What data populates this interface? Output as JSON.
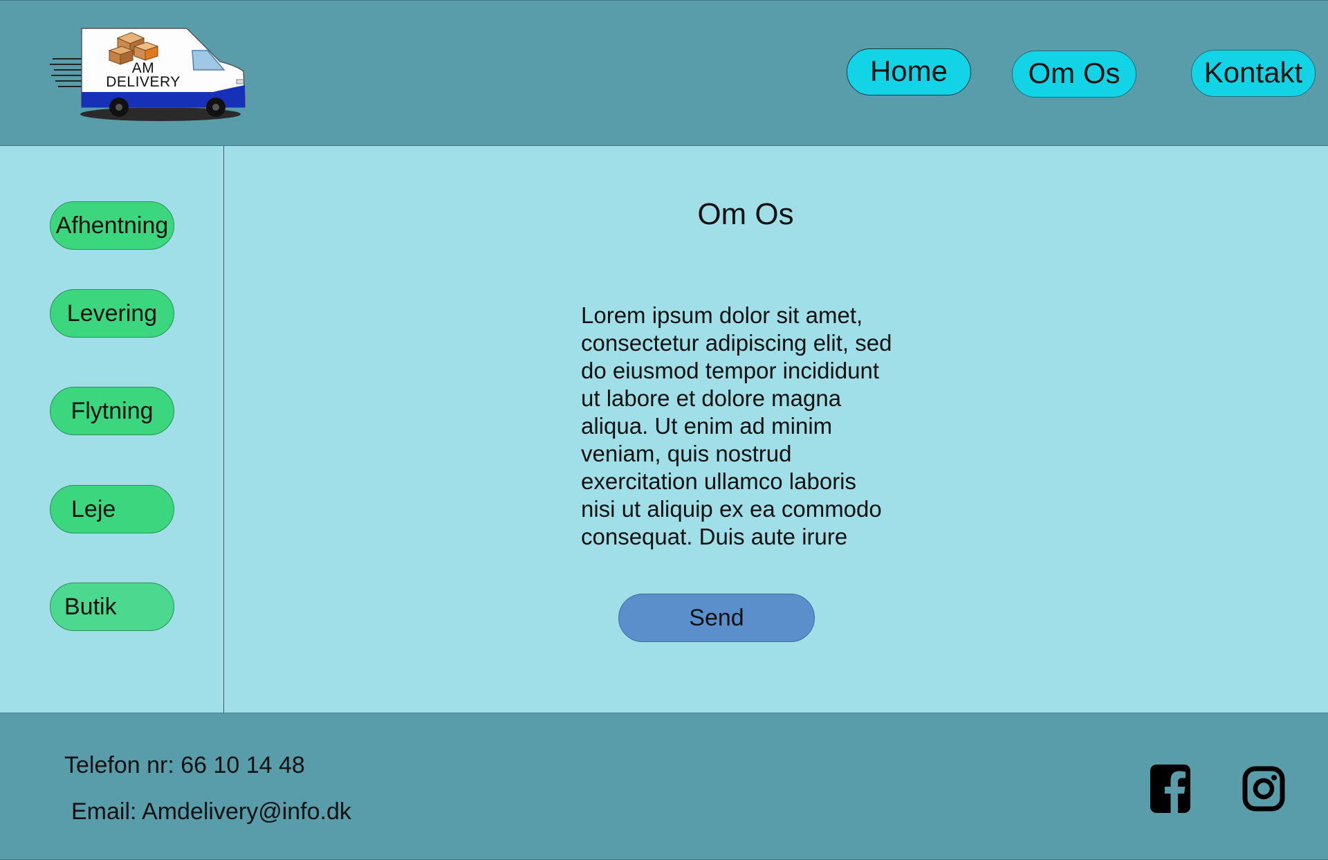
{
  "header": {
    "logo": {
      "line1": "AM",
      "line2": "DELIVERY"
    },
    "nav": [
      {
        "label": "Home"
      },
      {
        "label": "Om Os"
      },
      {
        "label": "Kontakt"
      }
    ]
  },
  "sidebar": {
    "items": [
      {
        "label": "Afhentning"
      },
      {
        "label": "Levering"
      },
      {
        "label": "Flytning"
      },
      {
        "label": "Leje"
      },
      {
        "label": "Butik"
      }
    ]
  },
  "main": {
    "title": "Om Os",
    "body": "Lorem ipsum dolor sit amet,\nconsectetur adipiscing elit, sed\ndo eiusmod tempor incididunt\nut labore et dolore magna\naliqua. Ut enim ad minim\nveniam, quis nostrud\nexercitation ullamco laboris\nnisi ut aliquip ex ea commodo\nconsequat. Duis aute irure",
    "send_label": "Send"
  },
  "footer": {
    "phone": "Telefon nr: 66 10 14 48",
    "email": "Email: Amdelivery@info.dk",
    "social_icons": [
      "facebook-icon",
      "instagram-icon"
    ]
  },
  "colors": {
    "header_bg": "#5a9daa",
    "page_bg": "#a0dfe8",
    "nav_button": "#12d4e6",
    "sidebar_button": "#3cd67e",
    "send_button": "#5b8fcb"
  }
}
